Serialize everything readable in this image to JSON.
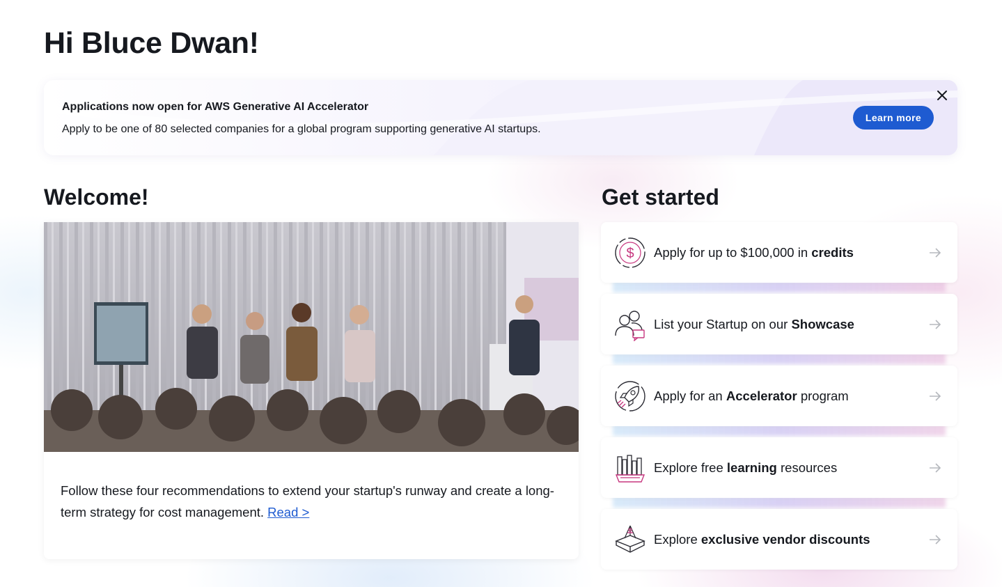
{
  "greeting": "Hi Bluce Dwan!",
  "banner": {
    "title": "Applications now open for AWS Generative AI Accelerator",
    "text": "Apply to be one of 80 selected companies for a global program supporting generative AI startups.",
    "button": "Learn more"
  },
  "welcome": {
    "heading": "Welcome!",
    "text": "Follow these four recommendations to extend your startup's runway and create a long-term strategy for cost management.",
    "link": "Read >"
  },
  "get_started": {
    "heading": "Get started",
    "items": [
      {
        "before": "Apply for up to $100,000 in ",
        "bold": "credits",
        "after": "",
        "icon": "dollar-icon"
      },
      {
        "before": "List your Startup on our ",
        "bold": "Showcase",
        "after": "",
        "icon": "people-icon"
      },
      {
        "before": "Apply for an ",
        "bold": "Accelerator",
        "after": " program",
        "icon": "rocket-icon"
      },
      {
        "before": "Explore free ",
        "bold": "learning",
        "after": " resources",
        "icon": "books-icon"
      },
      {
        "before": "Explore ",
        "bold": "exclusive vendor discounts",
        "after": "",
        "icon": "box-icon"
      }
    ]
  },
  "colors": {
    "accent": "#1e5bd1",
    "text": "#16191f"
  }
}
